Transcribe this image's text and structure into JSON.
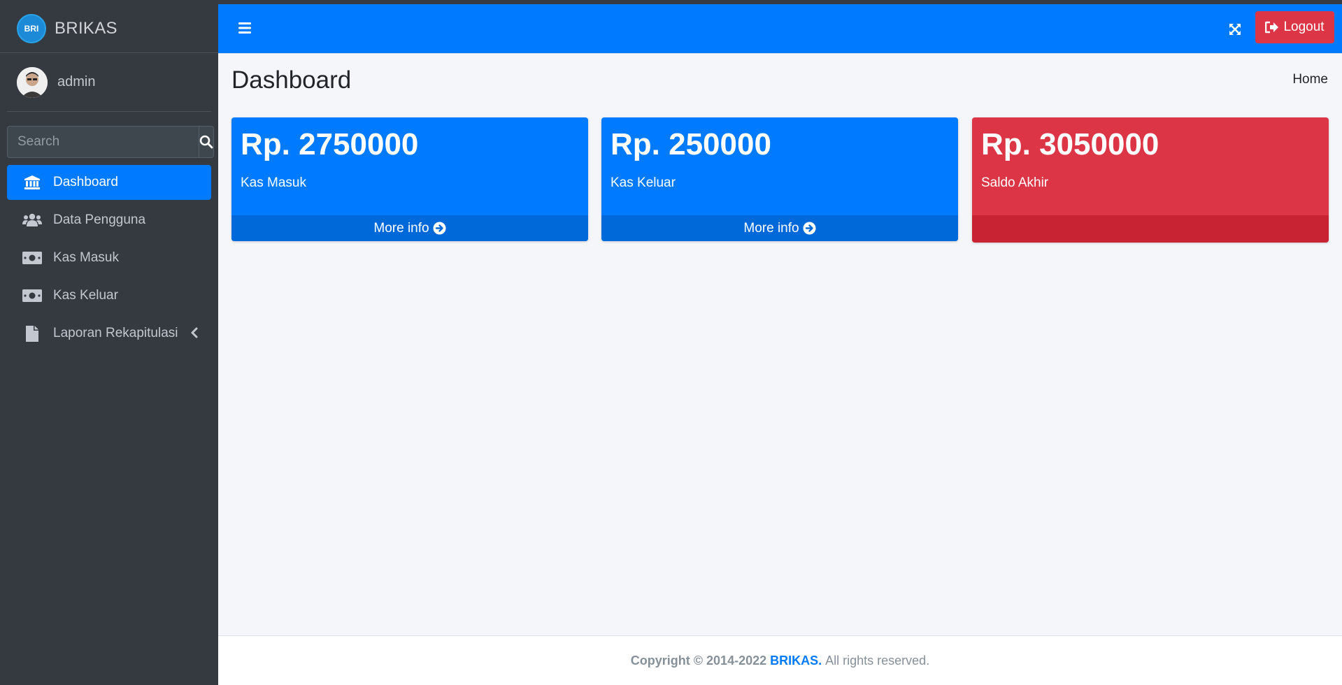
{
  "app": {
    "brand_name": "BRIKAS",
    "logo_text": "BRI"
  },
  "sidebar": {
    "user_name": "admin",
    "search_placeholder": "Search",
    "items": [
      {
        "label": "Dashboard",
        "icon": "bank-icon",
        "active": true
      },
      {
        "label": "Data Pengguna",
        "icon": "users-icon"
      },
      {
        "label": "Kas Masuk",
        "icon": "money-bill-icon"
      },
      {
        "label": "Kas Keluar",
        "icon": "money-bill-icon"
      },
      {
        "label": "Laporan Rekapitulasi",
        "icon": "file-icon",
        "has_children": true
      }
    ]
  },
  "header": {
    "logout_label": "Logout"
  },
  "page": {
    "title": "Dashboard",
    "breadcrumb": "Home"
  },
  "cards": [
    {
      "value": "Rp. 2750000",
      "label": "Kas Masuk",
      "footer": "More info",
      "color": "#007bff"
    },
    {
      "value": "Rp. 250000",
      "label": "Kas Keluar",
      "footer": "More info",
      "color": "#007bff"
    },
    {
      "value": "Rp. 3050000",
      "label": "Saldo Akhir",
      "footer": "",
      "color": "#dc3545"
    }
  ],
  "footer": {
    "copyright": "Copyright © 2014-2022",
    "brand_link": "BRIKAS.",
    "rights": "All rights reserved."
  }
}
